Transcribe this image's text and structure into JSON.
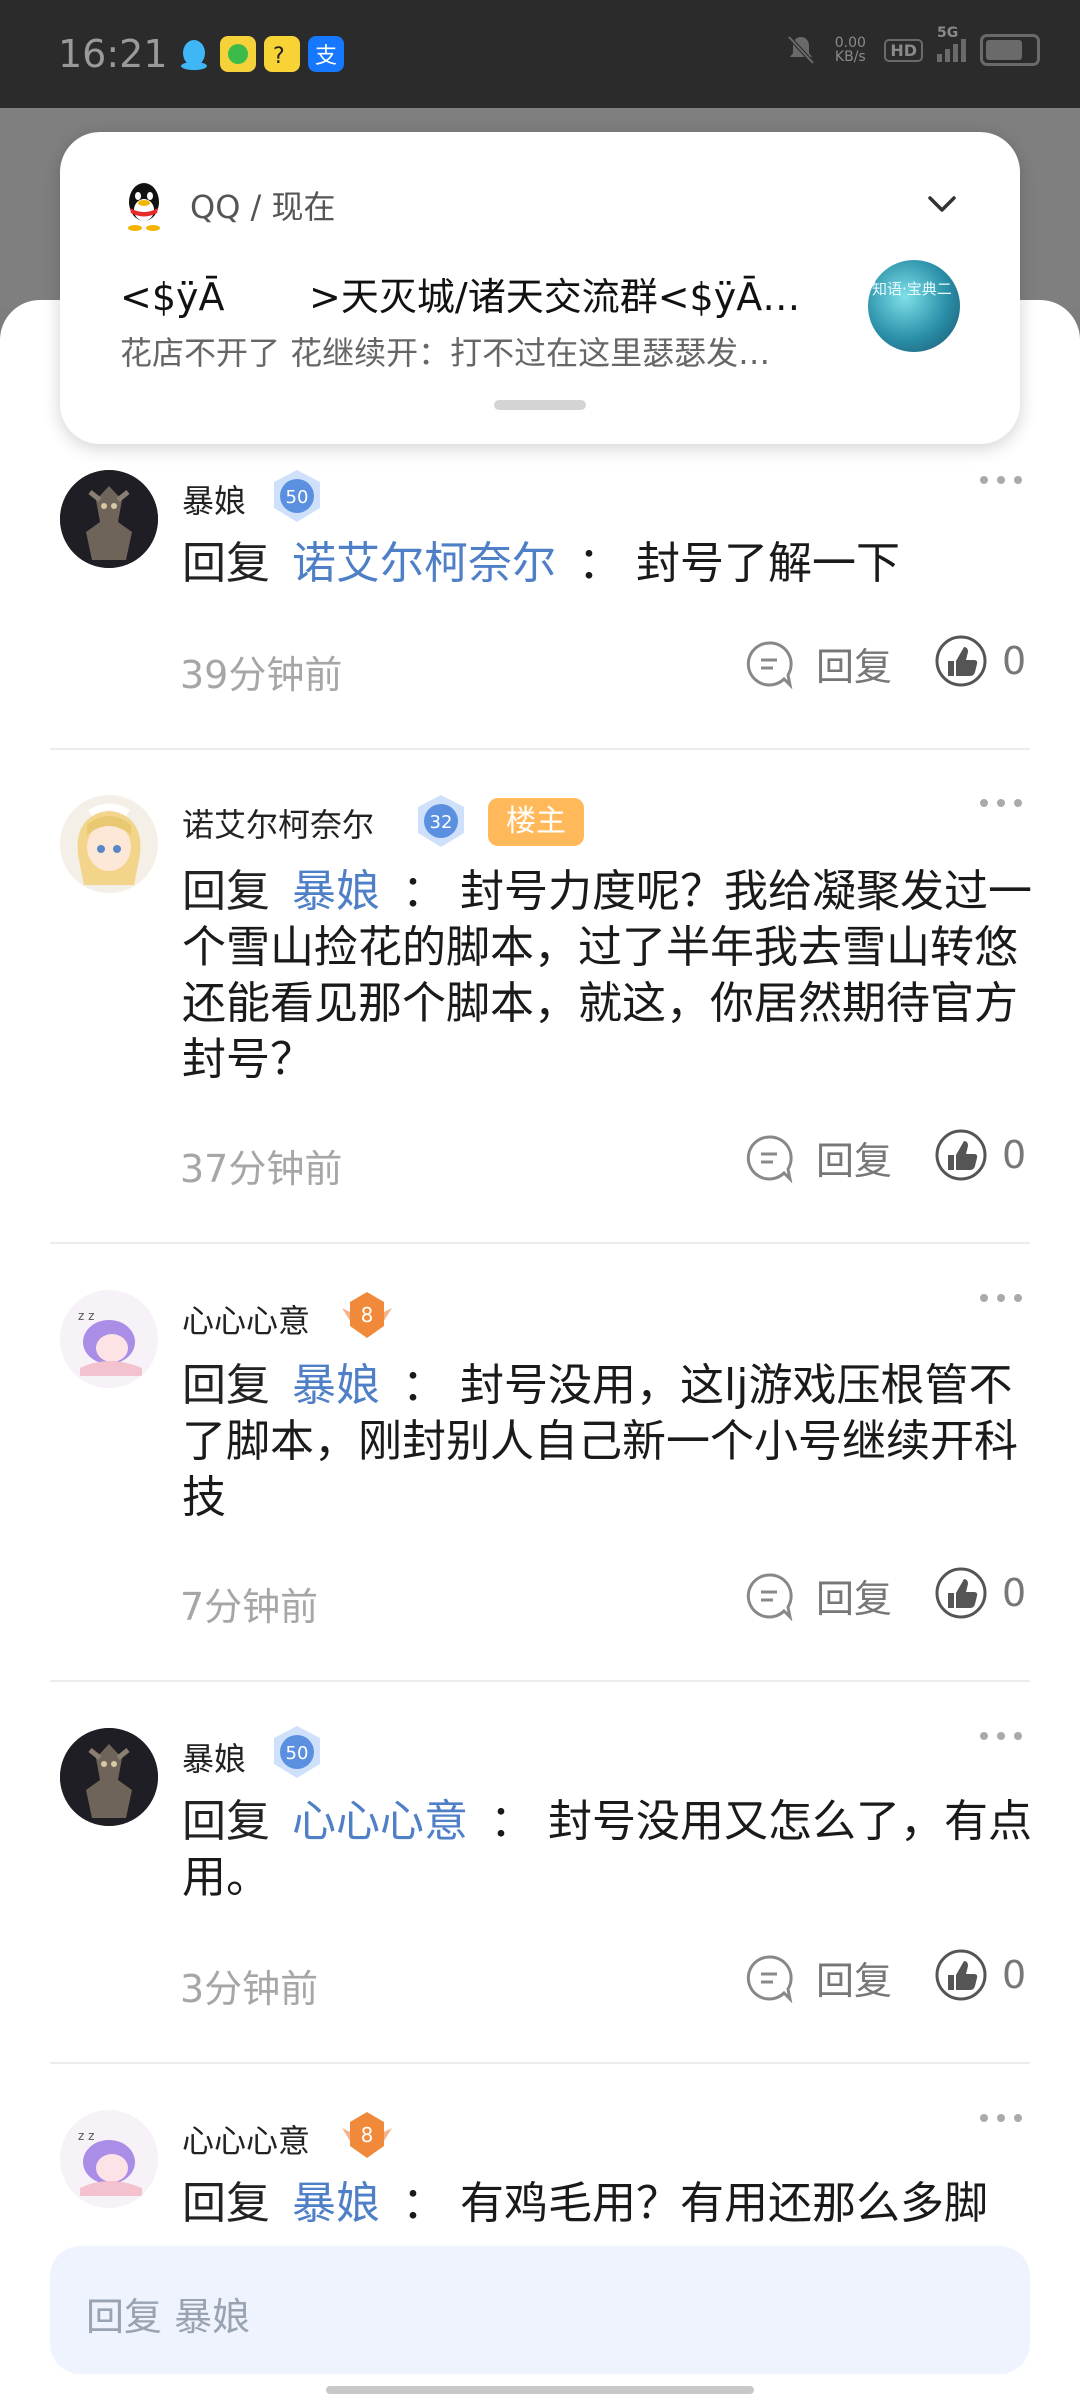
{
  "status_bar": {
    "time": "16:21",
    "net_speed": "0.00\nKB/s",
    "hd": "HD",
    "signal": "5G"
  },
  "notification": {
    "app": "QQ / 现在",
    "title": "<$ÿĀ       >天灭城/诸天交流群<$ÿĀ…",
    "body": "花店不开了  花继续开：打不过在这里瑟瑟发…",
    "thumb_text": "知语·宝典二"
  },
  "comments": [
    {
      "username": "暴娘",
      "level": "50",
      "is_owner": false,
      "reply_keyword": "回复",
      "mention": "诺艾尔柯奈尔",
      "colon": "：",
      "content": "封号了解一下",
      "time": "39分钟前",
      "reply_label": "回复",
      "likes": "0"
    },
    {
      "username": "诺艾尔柯奈尔",
      "level": "32",
      "is_owner": true,
      "owner_label": "楼主",
      "reply_keyword": "回复",
      "mention": "暴娘",
      "colon": "：",
      "content": "封号力度呢？我给凝聚发过一个雪山捡花的脚本，过了半年我去雪山转悠还能看见那个脚本，就这，你居然期待官方封号？",
      "time": "37分钟前",
      "reply_label": "回复",
      "likes": "0"
    },
    {
      "username": "心心心意",
      "level": "8",
      "is_owner": false,
      "reply_keyword": "回复",
      "mention": "暴娘",
      "colon": "：",
      "content": "封号没用，这lj游戏压根管不了脚本，刚封别人自己新一个小号继续开科技",
      "time": "7分钟前",
      "reply_label": "回复",
      "likes": "0"
    },
    {
      "username": "暴娘",
      "level": "50",
      "is_owner": false,
      "reply_keyword": "回复",
      "mention": "心心心意",
      "colon": "：",
      "content": "封号没用又怎么了，有点用。",
      "time": "3分钟前",
      "reply_label": "回复",
      "likes": "0"
    },
    {
      "username": "心心心意",
      "level": "8",
      "is_owner": false,
      "reply_keyword": "回复",
      "mention": "暴娘",
      "colon": "：",
      "content": "有鸡毛用？有用还那么多脚",
      "time": "",
      "reply_label": "",
      "likes": ""
    }
  ],
  "input": {
    "placeholder": "回复  暴娘"
  },
  "colors": {
    "mention": "#4f7fc6",
    "owner_tag": "#ffb95a",
    "badge_blue": "#5b8fe0",
    "badge_orange": "#f08a3a"
  }
}
